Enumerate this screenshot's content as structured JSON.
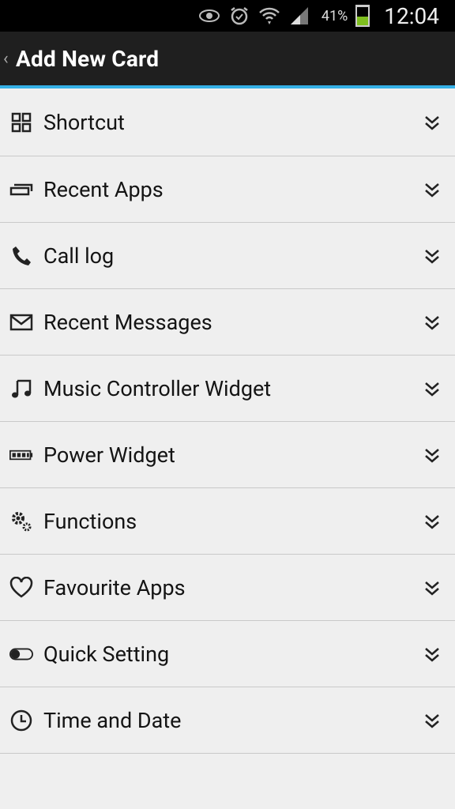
{
  "status_bar": {
    "battery_percent": "41%",
    "time": "12:04",
    "icons": [
      "eye-icon",
      "alarm-icon",
      "wifi-icon",
      "signal-icon",
      "battery-icon"
    ]
  },
  "action_bar": {
    "title": "Add New Card"
  },
  "list": {
    "items": [
      {
        "label": "Shortcut",
        "icon": "grid-icon"
      },
      {
        "label": "Recent Apps",
        "icon": "recent-apps-icon"
      },
      {
        "label": "Call log",
        "icon": "phone-icon"
      },
      {
        "label": "Recent Messages",
        "icon": "envelope-icon"
      },
      {
        "label": "Music Controller Widget",
        "icon": "music-note-icon"
      },
      {
        "label": "Power Widget",
        "icon": "battery-widget-icon"
      },
      {
        "label": "Functions",
        "icon": "gears-icon"
      },
      {
        "label": "Favourite Apps",
        "icon": "heart-icon"
      },
      {
        "label": "Quick Setting",
        "icon": "toggle-icon"
      },
      {
        "label": "Time and Date",
        "icon": "clock-icon"
      }
    ]
  },
  "colors": {
    "accent": "#35b0e6",
    "action_bar_bg": "#1f1f1f",
    "list_bg": "#efefef",
    "battery_fill": "#7fbf1f"
  }
}
